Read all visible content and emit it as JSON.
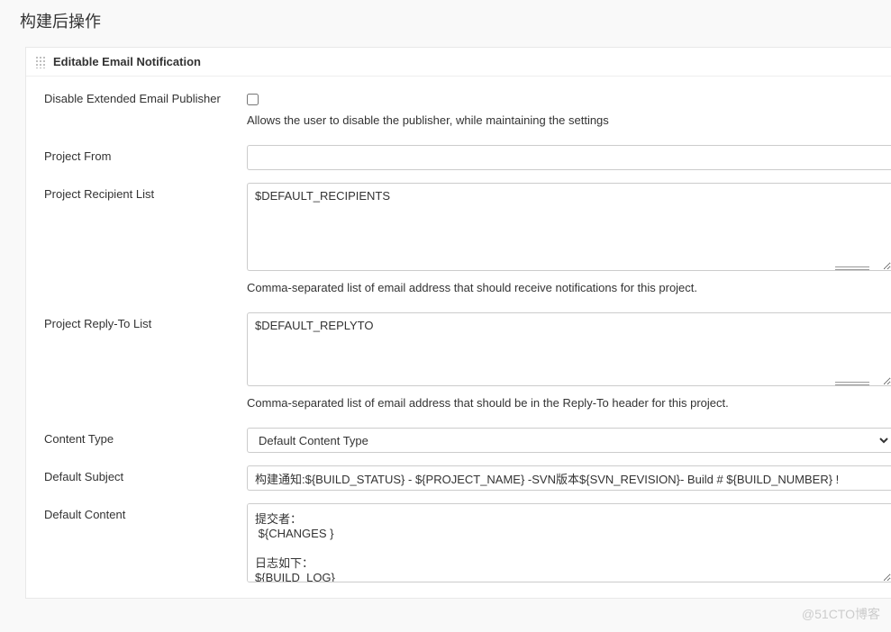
{
  "page": {
    "title": "构建后操作"
  },
  "section": {
    "title": "Editable Email Notification"
  },
  "form": {
    "disable_publisher": {
      "label": "Disable Extended Email Publisher",
      "checked": false,
      "help": "Allows the user to disable the publisher, while maintaining the settings"
    },
    "project_from": {
      "label": "Project From",
      "value": ""
    },
    "recipient_list": {
      "label": "Project Recipient List",
      "value": "$DEFAULT_RECIPIENTS",
      "help": "Comma-separated list of email address that should receive notifications for this project."
    },
    "replyto_list": {
      "label": "Project Reply-To List",
      "value": "$DEFAULT_REPLYTO",
      "help": "Comma-separated list of email address that should be in the Reply-To header for this project."
    },
    "content_type": {
      "label": "Content Type",
      "selected": "Default Content Type"
    },
    "default_subject": {
      "label": "Default Subject",
      "value": "构建通知:${BUILD_STATUS} - ${PROJECT_NAME} -SVN版本${SVN_REVISION}- Build # ${BUILD_NUMBER} !"
    },
    "default_content": {
      "label": "Default Content",
      "value": "提交者：\n ${CHANGES }\n\n日志如下：\n${BUILD_LOG}"
    }
  },
  "watermark": "@51CTO博客"
}
